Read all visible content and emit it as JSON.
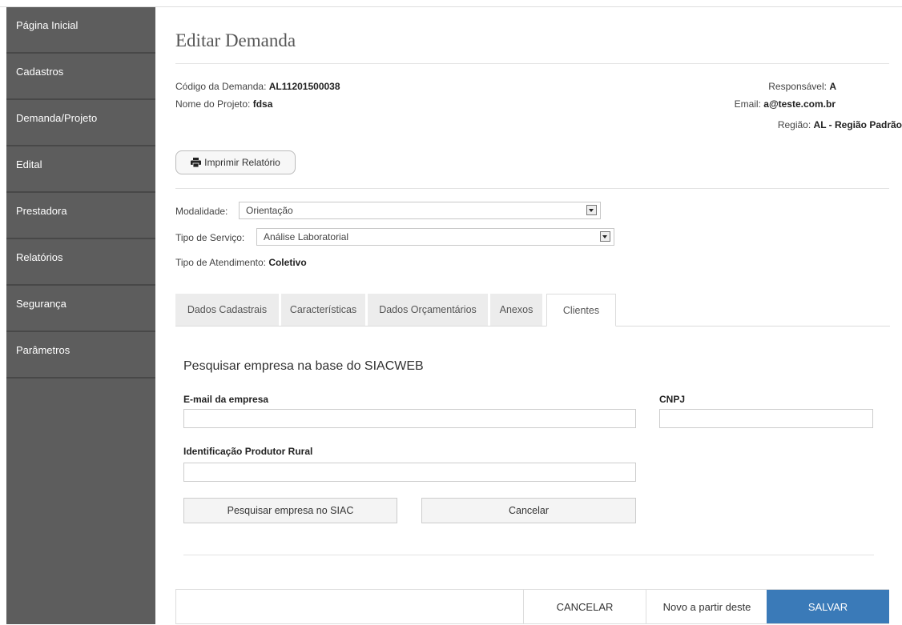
{
  "sidebar": {
    "items": [
      {
        "label": "Página Inicial"
      },
      {
        "label": "Cadastros"
      },
      {
        "label": "Demanda/Projeto"
      },
      {
        "label": "Edital"
      },
      {
        "label": "Prestadora"
      },
      {
        "label": "Relatórios"
      },
      {
        "label": "Segurança"
      },
      {
        "label": "Parâmetros"
      }
    ]
  },
  "page": {
    "title": "Editar Demanda"
  },
  "info": {
    "codigo_label": "Código da Demanda:",
    "codigo_value": "AL11201500038",
    "projeto_label": "Nome do Projeto:",
    "projeto_value": "fdsa",
    "responsavel_label": "Responsável:",
    "responsavel_value": "A",
    "email_label": "Email:",
    "email_value": "a@teste.com.br",
    "regiao_label": "Região:",
    "regiao_value": "AL - Região Padrão"
  },
  "print_button": {
    "label": "Imprimir Relatório",
    "icon": "printer-icon"
  },
  "form": {
    "modalidade_label": "Modalidade:",
    "modalidade_value": "Orientação",
    "tipo_servico_label": "Tipo de Serviço:",
    "tipo_servico_value": "Análise Laboratorial",
    "tipo_atendimento_label": "Tipo de Atendimento:",
    "tipo_atendimento_value": "Coletivo"
  },
  "tabs": [
    {
      "label": "Dados Cadastrais"
    },
    {
      "label": "Características"
    },
    {
      "label": "Dados Orçamentários"
    },
    {
      "label": "Anexos"
    },
    {
      "label": "Clientes"
    }
  ],
  "search": {
    "title": "Pesquisar empresa na base do SIACWEB",
    "email_label": "E-mail da empresa",
    "email_value": "",
    "cnpj_label": "CNPJ",
    "cnpj_value": "",
    "produtor_label": "Identificação Produtor Rural",
    "produtor_value": "",
    "search_button": "Pesquisar empresa no SIAC",
    "cancel_button": "Cancelar"
  },
  "footer": {
    "cancel": "CANCELAR",
    "novo": "Novo a partir deste",
    "save": "SALVAR"
  },
  "colors": {
    "sidebar_bg": "#5d5d5d",
    "save_bg": "#3a7ab8"
  }
}
